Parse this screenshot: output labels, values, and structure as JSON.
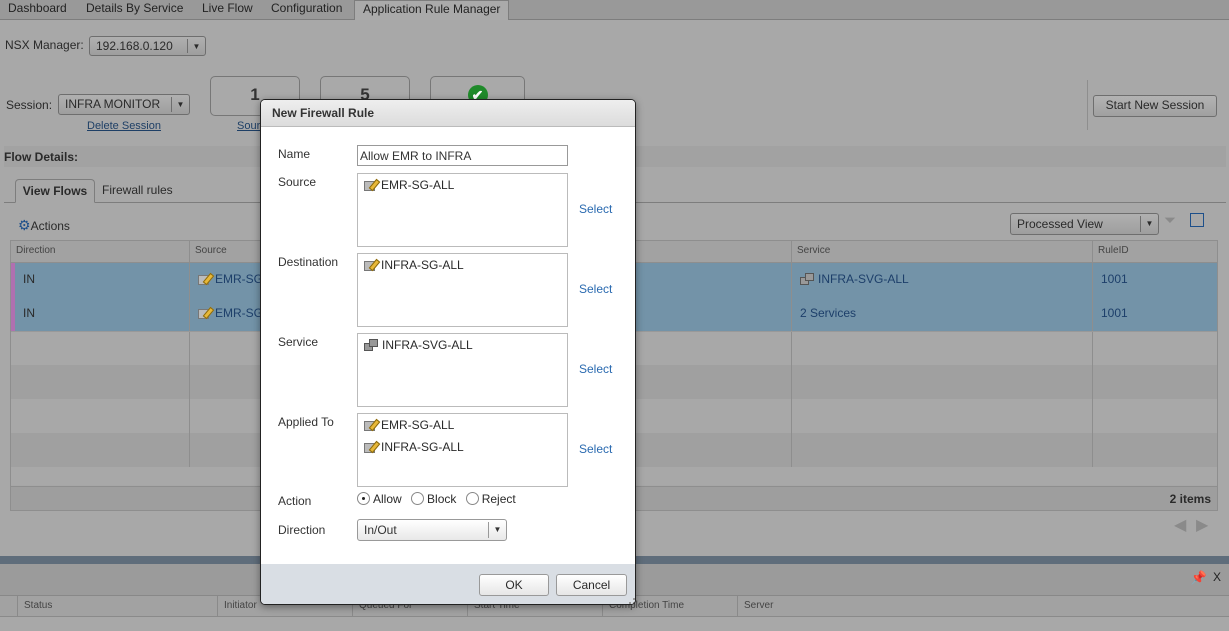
{
  "tabs": [
    "Dashboard",
    "Details By Service",
    "Live Flow",
    "Configuration",
    "Application Rule Manager"
  ],
  "nsx": {
    "label": "NSX Manager:",
    "value": "192.168.0.120"
  },
  "session": {
    "label": "Session:",
    "value": "INFRA MONITOR",
    "delete": "Delete Session"
  },
  "summary": [
    {
      "value": "1",
      "label": "Sources"
    },
    {
      "value": "5",
      "label": ""
    },
    {
      "value": "",
      "icon": "check-circle-icon",
      "color": "#1f8a2a"
    }
  ],
  "start_session": "Start New Session",
  "flow_details": "Flow Details:",
  "flow_tabs": [
    "View Flows",
    "Firewall rules"
  ],
  "actions": "Actions",
  "view_select": "Processed View",
  "grid": {
    "columns": {
      "direction": "Direction",
      "source": "Source",
      "service": "Service",
      "ruleid": "RuleID"
    },
    "rows": [
      {
        "direction": "IN",
        "source": "EMR-SG-ALL",
        "service": "INFRA-SVG-ALL",
        "ruleid": "1001"
      },
      {
        "direction": "IN",
        "source": "EMR-SG-ALL",
        "service": "2 Services",
        "ruleid": "1001"
      }
    ],
    "count": "2 items",
    "selected_color": "#7393a8"
  },
  "tasks": {
    "columns": [
      "Status",
      "Initiator",
      "Queued For",
      "Start Time",
      "Completion Time",
      "Server"
    ]
  },
  "modal": {
    "title": "New Firewall Rule",
    "name_label": "Name",
    "name_value": "Allow EMR to INFRA",
    "source_label": "Source",
    "source_items": [
      "EMR-SG-ALL"
    ],
    "destination_label": "Destination",
    "destination_items": [
      "INFRA-SG-ALL"
    ],
    "service_label": "Service",
    "service_items": [
      "INFRA-SVG-ALL"
    ],
    "applied_label": "Applied To",
    "applied_items": [
      "EMR-SG-ALL",
      "INFRA-SG-ALL"
    ],
    "select": "Select",
    "action_label": "Action",
    "actions": [
      "Allow",
      "Block",
      "Reject"
    ],
    "action_selected": "Allow",
    "direction_label": "Direction",
    "direction_value": "In/Out",
    "ok": "OK",
    "cancel": "Cancel"
  }
}
